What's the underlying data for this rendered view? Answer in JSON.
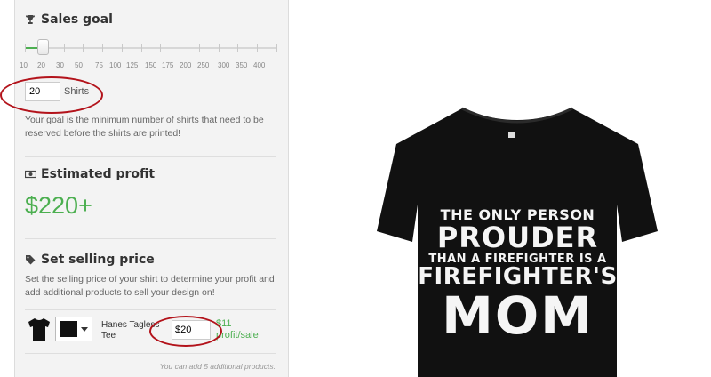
{
  "sales_goal": {
    "title": "Sales goal",
    "icon": "trophy-icon",
    "tick_labels": [
      "10",
      "20",
      "30",
      "50",
      "75",
      "100",
      "125",
      "150",
      "175",
      "200",
      "250",
      "300",
      "350",
      "400"
    ],
    "selected_value": "20",
    "unit": "Shirts",
    "note": "Your goal is the minimum number of shirts that need to be reserved before the shirts are printed!"
  },
  "estimated_profit": {
    "title": "Estimated profit",
    "icon": "money-icon",
    "value": "$220+"
  },
  "selling_price": {
    "title": "Set selling price",
    "icon": "tag-icon",
    "note": "Set the selling price of your shirt to determine your profit and add additional products to sell your design on!",
    "product": {
      "name": "Hanes Tagless Tee",
      "color": "#111111",
      "price": "$20",
      "profit": "$11",
      "profit_suffix": "profit/sale"
    },
    "add_note": "You can add 5 additional products."
  },
  "shirt_design": {
    "line1": "THE ONLY PERSON",
    "line2": "PROUDER",
    "line3": "THAN A FIREFIGHTER IS A",
    "line4": "FIREFIGHTER'S",
    "line5": "MOM"
  },
  "colors": {
    "accent_green": "#4caf50",
    "annotation_red": "#b3131b",
    "shirt": "#111111"
  }
}
